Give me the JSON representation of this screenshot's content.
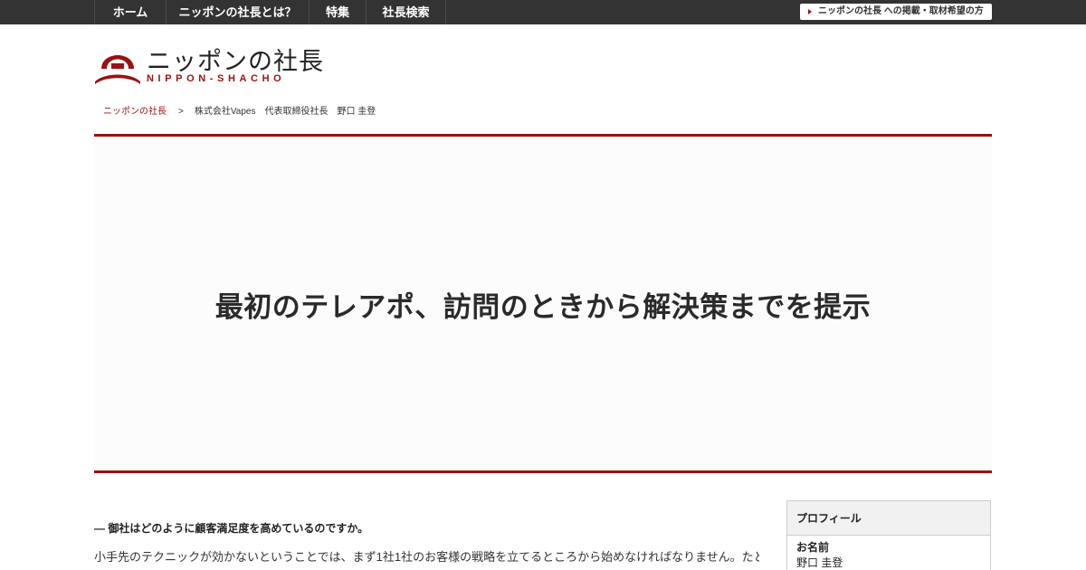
{
  "nav": {
    "items": [
      "ホーム",
      "ニッポンの社長とは？",
      "特集",
      "社長検索"
    ],
    "publish_label": "ニッポンの社長 への掲載・取材希望の方"
  },
  "logo": {
    "title": "ニッポンの社長",
    "subtitle": "NIPPON-SHACHO"
  },
  "breadcrumb": {
    "home": "ニッポンの社長",
    "separator": ">",
    "current": "株式会社Vapes　代表取締役社長　野口 圭登"
  },
  "hero": {
    "title": "最初のテレアポ、訪問のときから解決策までを提示"
  },
  "article": {
    "question": "― 御社はどのように顧客満足度を高めているのですか。",
    "paragraph": "小手先のテクニックが効かないということでは、まず1社1社のお客様の戦略を立てるところから始めなければなりません。たとえば、ホ"
  },
  "sidebar": {
    "profile_heading": "プロフィール",
    "name_label": "お名前",
    "name_value": "野口 圭登"
  },
  "colors": {
    "accent": "#9b1111",
    "topbar": "#333333",
    "hero_bg": "#fbfcfb"
  }
}
